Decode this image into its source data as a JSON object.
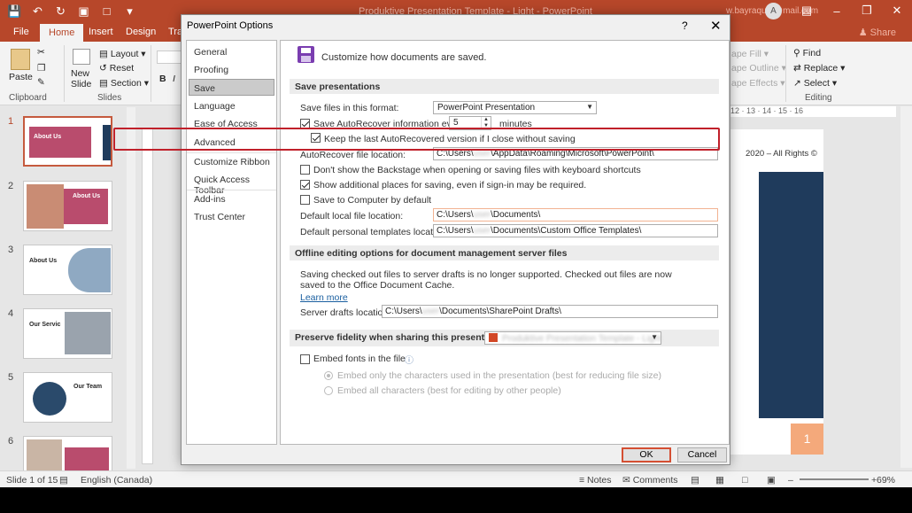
{
  "titlebar": {
    "doc_title": "Produktive Presentation Template - Light - PowerPoint",
    "user": "w.bayraqum@mail.com",
    "avatar": "A"
  },
  "menu": {
    "tabs": [
      "File",
      "Home",
      "Insert",
      "Design",
      "Tran"
    ],
    "active": "Home",
    "share": "Share"
  },
  "ribbon": {
    "paste": "Paste",
    "clipboard": "Clipboard",
    "new_slide": "New\nSlide",
    "slides": "Slides",
    "layout": "Layout",
    "reset": "Reset",
    "section": "Section",
    "shape_fill": "ape Fill",
    "shape_outline": "ape Outline",
    "shape_effects": "ape Effects",
    "find": "Find",
    "replace": "Replace",
    "select": "Select",
    "editing": "Editing"
  },
  "thumbs": {
    "numbers": [
      "1",
      "2",
      "3",
      "4",
      "5",
      "6"
    ],
    "titles": [
      "About Us",
      "About Us",
      "About Us",
      "Our Servic",
      "Our Team",
      ""
    ]
  },
  "slide": {
    "footer_text": "2020 – All Rights ©",
    "page_num": "1",
    "ruler": "12 · 13 · 14 · 15 · 16"
  },
  "status": {
    "slide_of": "Slide 1 of 15",
    "language": "English (Canada)",
    "notes": "Notes",
    "comments": "Comments",
    "zoom": "69%"
  },
  "dialog": {
    "title": "PowerPoint Options",
    "help": "?",
    "nav": [
      "General",
      "Proofing",
      "Save",
      "Language",
      "Ease of Access",
      "Advanced",
      "Customize Ribbon",
      "Quick Access Toolbar",
      "Add-ins",
      "Trust Center"
    ],
    "header": "Customize how documents are saved.",
    "sec_save": "Save presentations",
    "format_label": "Save files in this format:",
    "format_value": "PowerPoint Presentation",
    "autorecover_label": "Save AutoRecover information every",
    "autorecover_minutes": "5",
    "minutes": "minutes",
    "keep_last": "Keep the last AutoRecovered version if I close without saving",
    "ar_location_label": "AutoRecover file location:",
    "ar_location_prefix": "C:\\Users\\",
    "ar_location_user": "user",
    "ar_location_suffix": "\\AppData\\Roaming\\Microsoft\\PowerPoint\\",
    "dont_show_backstage": "Don't show the Backstage when opening or saving files with keyboard shortcuts",
    "show_additional": "Show additional places for saving, even if sign-in may be required.",
    "save_computer": "Save to Computer by default",
    "default_local_label": "Default local file location:",
    "default_local_suffix": "\\Documents\\",
    "default_templates_label": "Default personal templates location:",
    "default_templates_suffix": "\\Documents\\Custom Office Templates\\",
    "sec_offline": "Offline editing options for document management server files",
    "offline_text": "Saving checked out files to server drafts is no longer supported. Checked out files are now saved to the Office Document Cache.",
    "learn_more": "Learn more",
    "server_drafts_label": "Server drafts location:",
    "server_drafts_suffix": "\\Documents\\SharePoint Drafts\\",
    "sec_fidelity": "Preserve fidelity when sharing this presentation:",
    "fidelity_doc": "Produktive Presentation Template - Light",
    "embed_fonts": "Embed fonts in the file",
    "embed_only": "Embed only the characters used in the presentation (best for reducing file size)",
    "embed_all": "Embed all characters (best for editing by other people)",
    "ok": "OK",
    "cancel": "Cancel"
  },
  "colors": {
    "accent": "#b7472a",
    "highlight": "#c0202a",
    "purple": "#7a3db0"
  }
}
